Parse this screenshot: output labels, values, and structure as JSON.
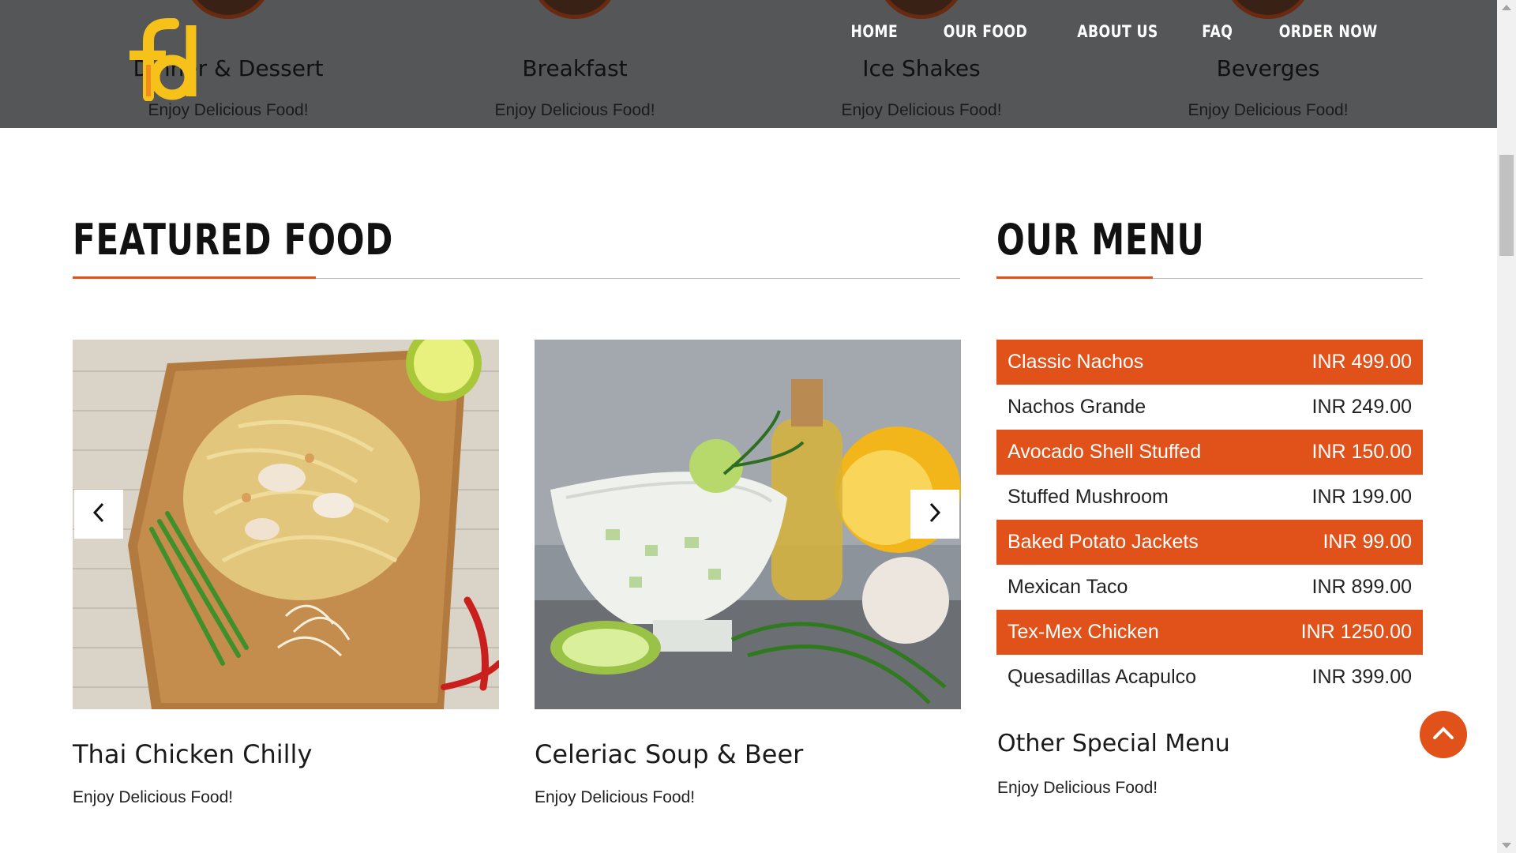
{
  "header": {
    "categories": [
      {
        "title": "Dinner & Dessert",
        "subtitle": "Enjoy Delicious Food!"
      },
      {
        "title": "Breakfast",
        "subtitle": "Enjoy Delicious Food!"
      },
      {
        "title": "Ice Shakes",
        "subtitle": "Enjoy Delicious Food!"
      },
      {
        "title": "Beverges",
        "subtitle": "Enjoy Delicious Food!"
      }
    ],
    "logo_text": "fd"
  },
  "nav": {
    "items": [
      {
        "label": "HOME"
      },
      {
        "label": "OUR FOOD"
      },
      {
        "label": "ABOUT US"
      },
      {
        "label": "FAQ"
      },
      {
        "label": "ORDER NOW"
      }
    ]
  },
  "featured": {
    "title": "FEATURED FOOD",
    "cards": [
      {
        "title": "Thai Chicken Chilly",
        "subtitle": "Enjoy Delicious Food!"
      },
      {
        "title": "Celeriac Soup & Beer",
        "subtitle": "Enjoy Delicious Food!"
      }
    ],
    "prev_icon": "chevron-left-icon",
    "next_icon": "chevron-right-icon"
  },
  "menu": {
    "title": "OUR MENU",
    "items": [
      {
        "name": "Classic Nachos",
        "price": "INR 499.00"
      },
      {
        "name": "Nachos Grande",
        "price": "INR 249.00"
      },
      {
        "name": "Avocado Shell Stuffed",
        "price": "INR 150.00"
      },
      {
        "name": "Stuffed Mushroom",
        "price": "INR 199.00"
      },
      {
        "name": "Baked Potato Jackets",
        "price": "INR 99.00"
      },
      {
        "name": "Mexican Taco",
        "price": "INR 899.00"
      },
      {
        "name": "Tex-Mex Chicken",
        "price": "INR 1250.00"
      },
      {
        "name": "Quesadillas Acapulco",
        "price": "INR 399.00"
      }
    ],
    "other_title": "Other Special Menu",
    "other_subtitle": "Enjoy Delicious Food!"
  },
  "colors": {
    "accent": "#e05219",
    "header_bg": "#555657",
    "logo_yellow": "#f6c21a",
    "logo_orange": "#f28a1e"
  },
  "scroll_to_top_icon": "chevron-up-icon"
}
